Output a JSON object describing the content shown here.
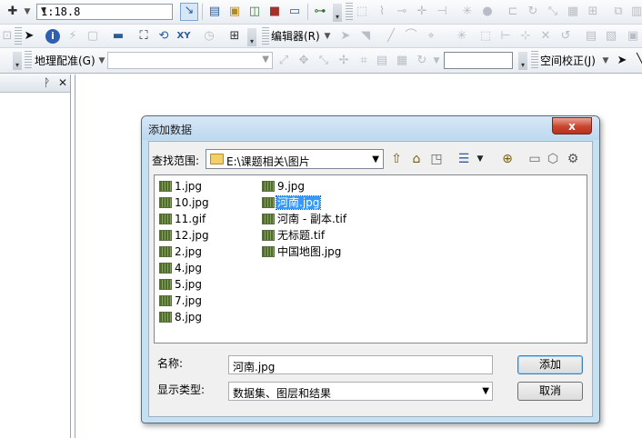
{
  "toolbar1": {
    "scale": "1:18.8"
  },
  "toolbar2": {
    "editor_menu": "编辑器(R)"
  },
  "toolbar3": {
    "georeferencing_menu": "地理配准(G)",
    "spatial_adjustment_menu": "空间校正(J)"
  },
  "left_panel": {
    "pin": "ᚹ",
    "close": "✕"
  },
  "dialog": {
    "title": "添加数据",
    "close_label": "x",
    "look_in_label": "查找范围:",
    "look_in_value": "E:\\课题相关\\图片",
    "files_col1": [
      "1.jpg",
      "10.jpg",
      "11.gif",
      "12.jpg",
      "2.jpg",
      "4.jpg",
      "5.jpg",
      "7.jpg",
      "8.jpg"
    ],
    "files_col2": [
      "9.jpg",
      "河南.jpg",
      "河南 - 副本.tif",
      "无标题.tif",
      "中国地图.jpg"
    ],
    "selected_file": "河南.jpg",
    "name_label": "名称:",
    "name_value": "河南.jpg",
    "type_label": "显示类型:",
    "type_value": "数据集、图层和结果",
    "add_button": "添加",
    "cancel_button": "取消"
  },
  "colors": {
    "selection": "#3399ff",
    "dialog_frame": "#c5dff3",
    "close_button": "#c7442d"
  }
}
